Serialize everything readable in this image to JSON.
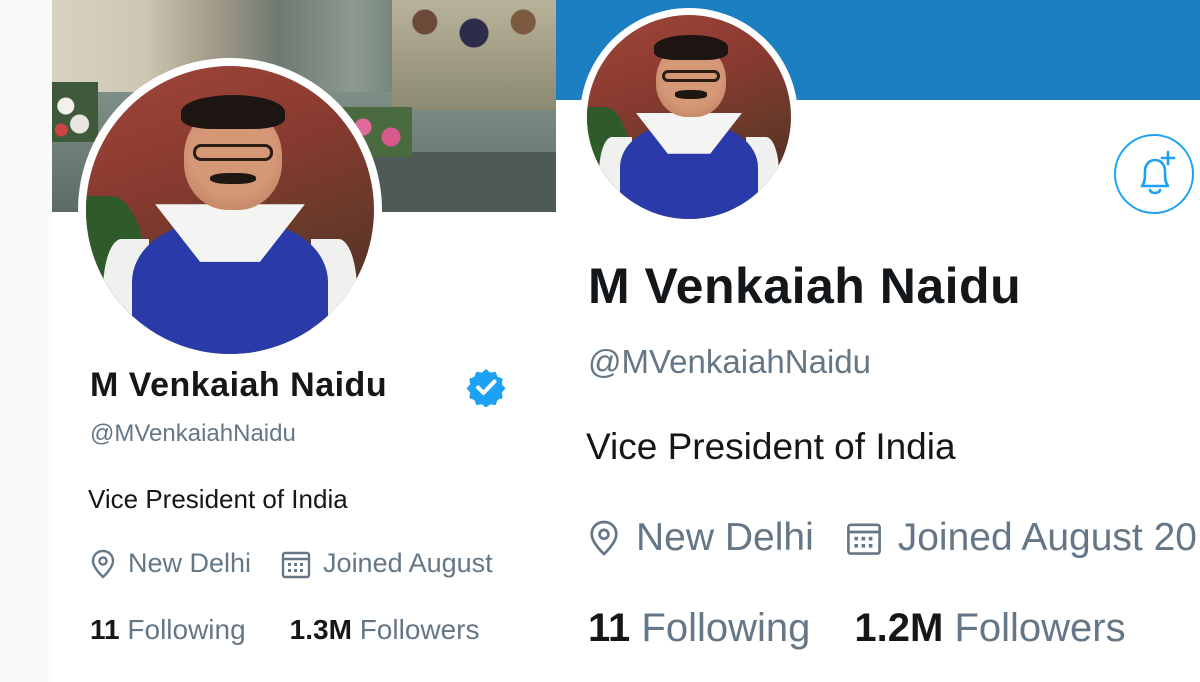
{
  "profile_left": {
    "display_name": "M Venkaiah Naidu",
    "handle": "@MVenkaiahNaidu",
    "bio": "Vice President of India",
    "location": "New Delhi",
    "joined": "Joined August",
    "following_count": "11",
    "following_label": "Following",
    "followers_count": "1.3M",
    "followers_label": "Followers",
    "verified": true
  },
  "profile_right": {
    "display_name": "M Venkaiah Naidu",
    "handle": "@MVenkaiahNaidu",
    "bio": "Vice President of India",
    "location": "New Delhi",
    "joined": "Joined August 20",
    "following_count": "11",
    "following_label": "Following",
    "followers_count": "1.2M",
    "followers_label": "Followers",
    "verified": false
  },
  "colors": {
    "accent": "#1da1f2",
    "banner_right": "#1b7fc1",
    "text_primary": "#14171a",
    "text_secondary": "#657786"
  },
  "icons": [
    "verified-badge-icon",
    "location-pin-icon",
    "calendar-icon",
    "bell-plus-icon"
  ]
}
